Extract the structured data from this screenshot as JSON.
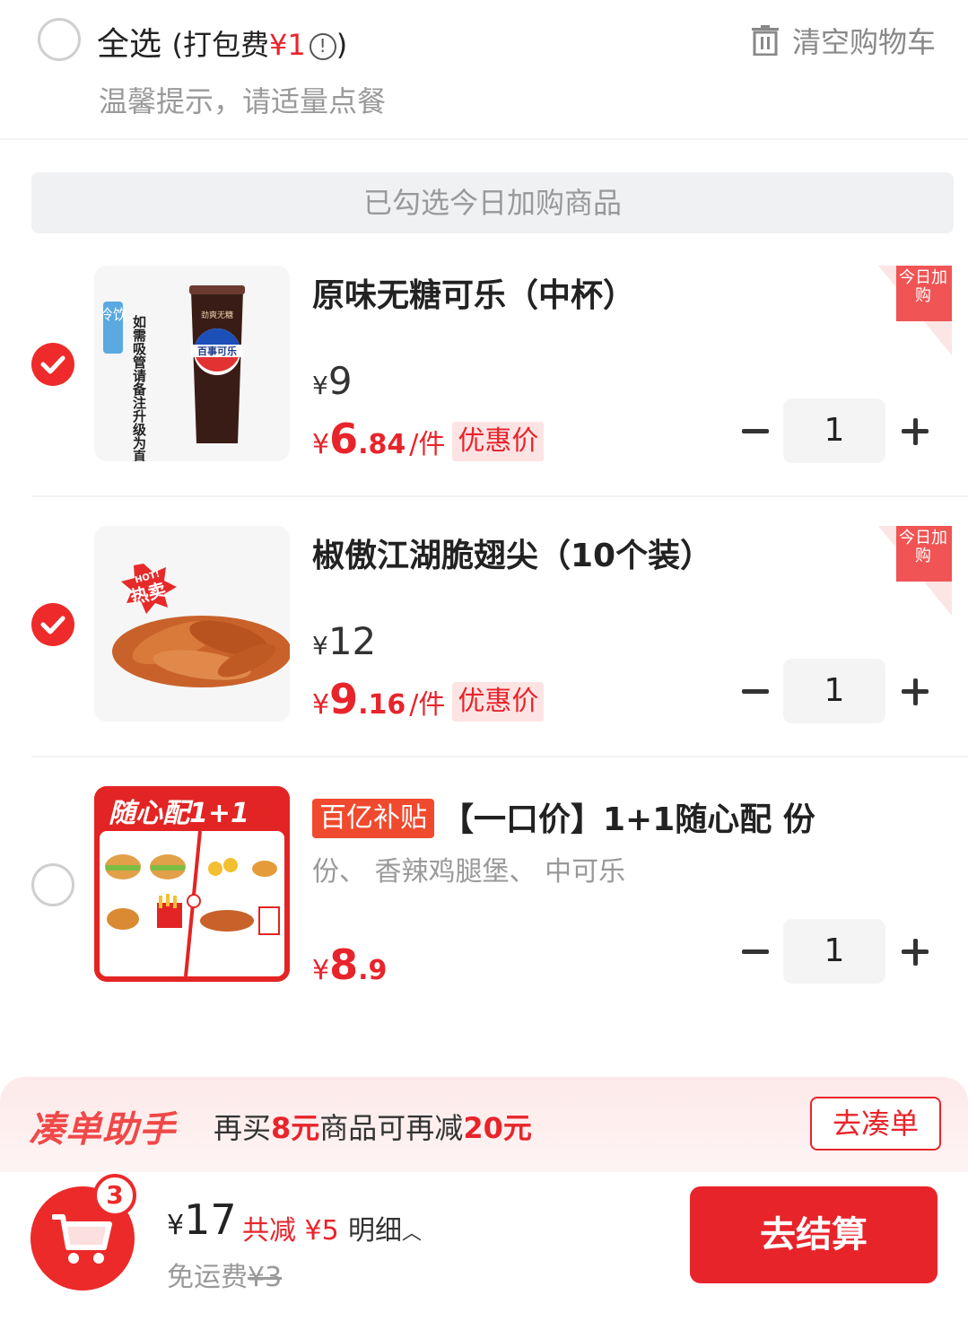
{
  "header": {
    "select_all": "全选",
    "packaging_fee_label": "(打包费",
    "packaging_fee_value": "¥1",
    "packaging_fee_close": ")",
    "info_glyph": "!",
    "tip": "温馨提示，请适量点餐",
    "clear_cart": "清空购物车"
  },
  "banner": "已勾选今日加购商品",
  "items": [
    {
      "checked": true,
      "title": "原味无糖可乐（中杯）",
      "orig_price_symbol": "¥",
      "orig_price": "9",
      "deal_symbol": "¥",
      "deal_int": "6",
      "deal_dec": ".84",
      "unit": "/件",
      "deal_tag": "优惠价",
      "corner_tag": "今日加购",
      "qty": "1",
      "thumb_label_cold": "冷饮",
      "thumb_note": "如需吸管请备注升级为直饮杯盖",
      "thumb_brand": "百事可乐",
      "thumb_top": "劲爽无糖"
    },
    {
      "checked": true,
      "title": "椒傲江湖脆翅尖（10个装）",
      "orig_price_symbol": "¥",
      "orig_price": "12",
      "deal_symbol": "¥",
      "deal_int": "9",
      "deal_dec": ".16",
      "unit": "/件",
      "deal_tag": "优惠价",
      "corner_tag": "今日加购",
      "qty": "1",
      "thumb_badge_top": "HOT!",
      "thumb_badge": "热卖"
    },
    {
      "checked": false,
      "subsidy_tag": "百亿补贴",
      "title": "【一口价】1+1随心配 份",
      "desc": "份、 香辣鸡腿堡、 中可乐",
      "price_symbol": "¥",
      "price_int": "8",
      "price_dec": ".9",
      "qty": "1",
      "thumb_banner": "随心配1+1"
    }
  ],
  "assistant": {
    "brand": "凑单助手",
    "msg_pre": "再买",
    "msg_amount": "8元",
    "msg_mid": "商品可再减",
    "msg_discount": "20元",
    "button": "去凑单"
  },
  "footer": {
    "cart_count": "3",
    "total_symbol": "¥",
    "total": "17",
    "saving": "共减 ¥5",
    "detail": "明细",
    "detail_arrow": "︿",
    "shipping_label": "免运费",
    "shipping_old": "¥3",
    "checkout": "去结算"
  },
  "colors": {
    "accent": "#e8242b",
    "muted": "#999999",
    "banner_bg": "#f0f1f3"
  }
}
